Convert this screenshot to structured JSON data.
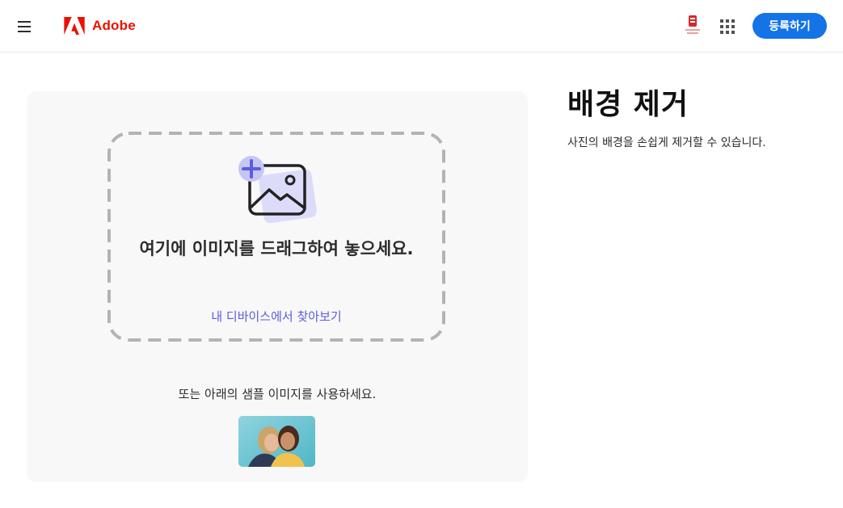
{
  "header": {
    "brand": "Adobe",
    "signup_label": "등록하기"
  },
  "upload": {
    "drop_text": "여기에 이미지를 드래그하여 놓으세요.",
    "browse_label": "내 디바이스에서 찾아보기",
    "sample_text": "또는 아래의 샘플 이미지를 사용하세요."
  },
  "main": {
    "title": "배경 제거",
    "description": "사진의 배경을 손쉽게 제거할 수 있습니다."
  },
  "icons": [
    "hamburger-menu-icon",
    "adobe-logo-icon",
    "profile-badge-icon",
    "apps-grid-icon",
    "add-image-icon"
  ],
  "colors": {
    "accent": "#1473e6",
    "brand": "#eb1000",
    "link": "#5c5ce0",
    "panel_bg": "#f8f8f8"
  }
}
